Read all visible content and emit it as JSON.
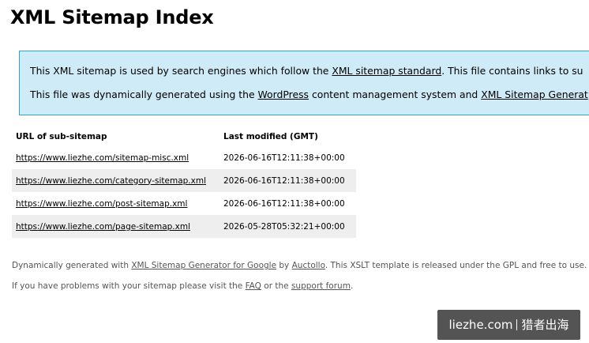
{
  "title": "XML Sitemap Index",
  "intro": {
    "line1_pre": "This XML sitemap is used by search engines which follow the ",
    "line1_link": "XML sitemap standard",
    "line1_post": ". This file contains links to su",
    "line2_pre": "This file was dynamically generated using the ",
    "line2_link1": "WordPress",
    "line2_mid": " content management system and ",
    "line2_link2": "XML Sitemap Generat"
  },
  "table": {
    "headers": [
      "URL of sub-sitemap",
      "Last modified (GMT)"
    ],
    "rows": [
      {
        "url": "https://www.liezhe.com/sitemap-misc.xml",
        "modified": "2026-06-16T12:11:38+00:00"
      },
      {
        "url": "https://www.liezhe.com/category-sitemap.xml",
        "modified": "2026-06-16T12:11:38+00:00"
      },
      {
        "url": "https://www.liezhe.com/post-sitemap.xml",
        "modified": "2026-06-16T12:11:38+00:00"
      },
      {
        "url": "https://www.liezhe.com/page-sitemap.xml",
        "modified": "2026-05-28T05:32:21+00:00"
      }
    ]
  },
  "footer": {
    "line1_pre": "Dynamically generated with ",
    "line1_link1": "XML Sitemap Generator for Google",
    "line1_mid": " by ",
    "line1_link2": "Auctollo",
    "line1_post": ". This XSLT template is released under the GPL and free to use.",
    "line2_pre": "If you have problems with your sitemap please visit the ",
    "line2_link1": "FAQ",
    "line2_mid": " or the ",
    "line2_link2": "support forum",
    "line2_post": "."
  },
  "watermark": {
    "site": "liezhe.com",
    "name": "猎者出海"
  },
  "colors": {
    "intro_background": "#cfebf7",
    "intro_border": "#2ba6cb",
    "row_stripe": "#eeeeee"
  }
}
